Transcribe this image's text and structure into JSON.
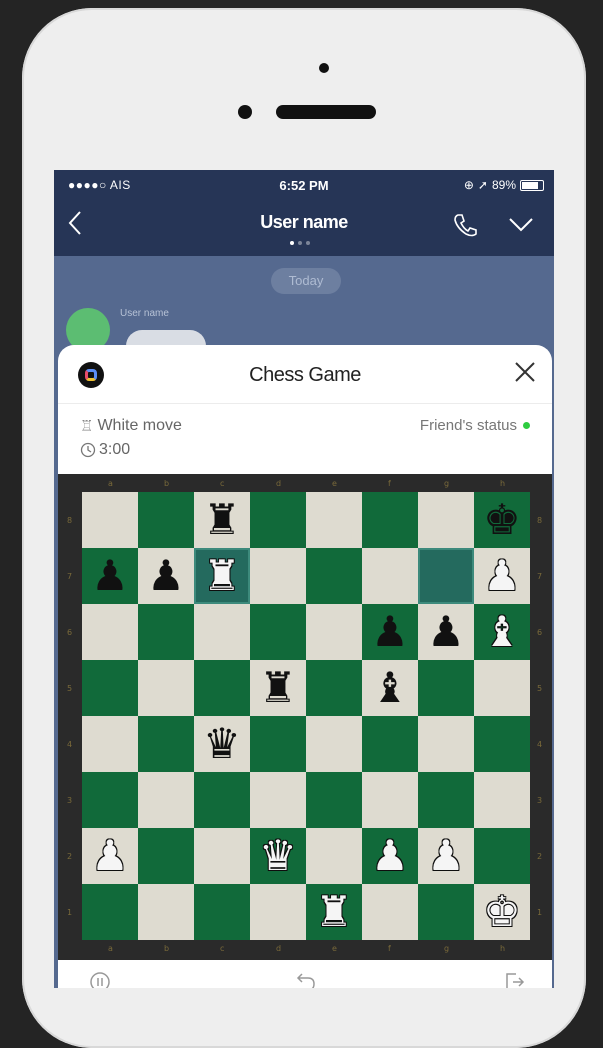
{
  "status_bar": {
    "carrier": "●●●●○ AIS",
    "time": "6:52 PM",
    "battery": "89%",
    "battery_level": 0.89
  },
  "nav": {
    "title": "User name"
  },
  "chat": {
    "date_label": "Today",
    "sender_name": "User name"
  },
  "game": {
    "title": "Chess Game",
    "turn_label": "White move",
    "timer": "3:00",
    "friend_status_label": "Friend's status",
    "friend_online_color": "#2ecc40"
  },
  "board": {
    "files": [
      "a",
      "b",
      "c",
      "d",
      "e",
      "f",
      "g",
      "h"
    ],
    "ranks": [
      "8",
      "7",
      "6",
      "5",
      "4",
      "3",
      "2",
      "1"
    ],
    "highlighted_squares": [
      "c7",
      "g7"
    ],
    "pieces": {
      "c8": "b-rook",
      "h8": "b-king",
      "a7": "b-pawn",
      "b7": "b-pawn",
      "c7": "w-rook",
      "h7": "w-pawn",
      "f6": "b-pawn",
      "g6": "b-pawn",
      "h6": "w-bishop",
      "d5": "b-rook",
      "f5": "b-bishop",
      "c4": "b-queen",
      "a2": "w-pawn",
      "d2": "w-queen",
      "f2": "w-pawn",
      "g2": "w-pawn",
      "e1": "w-rook",
      "h1": "w-king"
    },
    "colors": {
      "light": "#dedbd0",
      "dark": "#116a3a",
      "highlight": "#246a5e"
    }
  },
  "toolbar": {
    "icons": [
      "pause-icon",
      "undo-icon",
      "exit-icon"
    ]
  }
}
